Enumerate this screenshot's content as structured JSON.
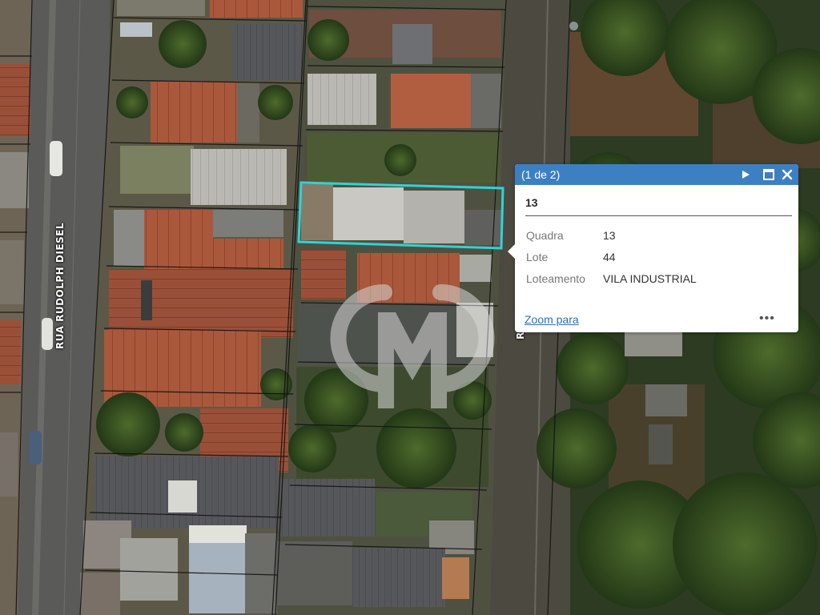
{
  "map": {
    "street_left": "RUA RUDOLPH DIESEL",
    "street_right": "R"
  },
  "popup": {
    "count": "(1 de 2)",
    "title": "13",
    "attributes": [
      {
        "key": "Quadra",
        "value": "13"
      },
      {
        "key": "Lote",
        "value": "44"
      },
      {
        "key": "Loteamento",
        "value": "VILA INDUSTRIAL"
      }
    ],
    "zoom_link": "Zoom para",
    "more": "•••",
    "icons": [
      "next-arrow-icon",
      "maximize-icon",
      "close-icon"
    ],
    "header_color": "#3d7fc3"
  },
  "highlight_color": "#2fd3d8"
}
